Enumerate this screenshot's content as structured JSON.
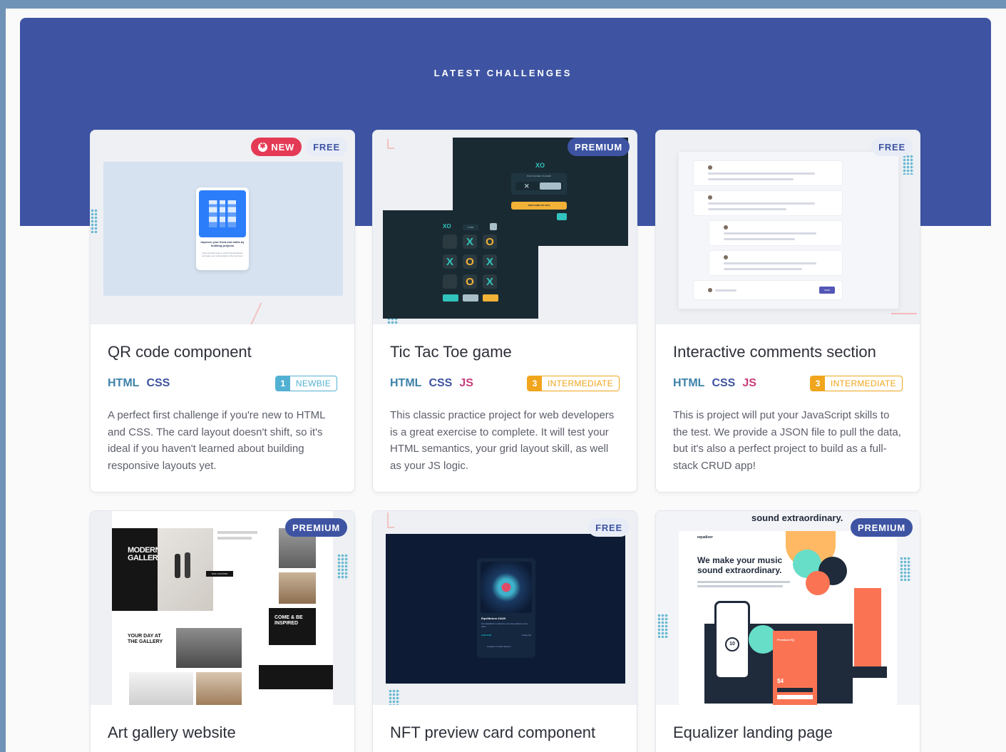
{
  "section": {
    "title": "LATEST CHALLENGES"
  },
  "colors": {
    "banner": "#3e54a3",
    "html": "#3e82aa",
    "css": "#3e54a3",
    "js": "#c73d7b",
    "newbie": "#52b1d2",
    "intermediate": "#f0a51c",
    "new_badge": "#e43a55"
  },
  "cards": [
    {
      "title": "QR code component",
      "badge_new": "NEW",
      "badge_access": "FREE",
      "langs": [
        "HTML",
        "CSS"
      ],
      "level_num": "1",
      "level_label": "NEWBIE",
      "description": "A perfect first challenge if you're new to HTML and CSS. The card layout doesn't shift, so it's ideal if you haven't learned about building responsive layouts yet.",
      "preview": {
        "qr_caption": "Improve your front-end skills by building projects",
        "qr_sub": "Scan the QR code to visit Frontend Mentor and take your coding skills to the next level"
      }
    },
    {
      "title": "Tic Tac Toe game",
      "badge_access": "PREMIUM",
      "langs": [
        "HTML",
        "CSS",
        "JS"
      ],
      "level_num": "3",
      "level_label": "INTERMEDIATE",
      "description": "This classic practice project for web developers is a great exercise to complete. It will test your HTML semantics, your grid layout skill, as well as your JS logic.",
      "preview": {
        "logo": "XO",
        "pick_text": "PICK PLAYER 1'S MARK",
        "new_game": "NEW GAME (VS CPU)",
        "turn": "TURN",
        "cells": [
          "",
          "X",
          "O",
          "X",
          "O",
          "X",
          "",
          "O",
          "X"
        ]
      }
    },
    {
      "title": "Interactive comments section",
      "badge_access": "FREE",
      "langs": [
        "HTML",
        "CSS",
        "JS"
      ],
      "level_num": "3",
      "level_label": "INTERMEDIATE",
      "description": "This is project will put your JavaScript skills to the test. We provide a JSON file to pull the data, but it's also a perfect project to build as a full-stack CRUD app!",
      "preview": {
        "send": "SEND"
      }
    },
    {
      "title": "Art gallery website",
      "badge_access": "PREMIUM",
      "preview": {
        "heading1": "MODERN ART GALLERY",
        "heading2": "YOUR DAY AT THE GALLERY",
        "heading3": "COME & BE INSPIRED",
        "cta": "OUR LOCATION"
      }
    },
    {
      "title": "NFT preview card component",
      "badge_access": "FREE",
      "preview": {
        "nft_name": "Equilibrium #3429",
        "nft_desc": "Our Equilibrium collection promotes balance and calm.",
        "price": "0.041 ETH",
        "time": "3 days left",
        "creator": "Creation of Jules Wyvern"
      }
    },
    {
      "title": "Equalizer landing page",
      "badge_access": "PREMIUM",
      "preview": {
        "top_text": "sound extraordinary.",
        "logo": "equalizer",
        "headline": "We make your music sound extraordinary.",
        "score": "10",
        "premium_label": "Premium EQ",
        "price": "$4"
      }
    }
  ]
}
